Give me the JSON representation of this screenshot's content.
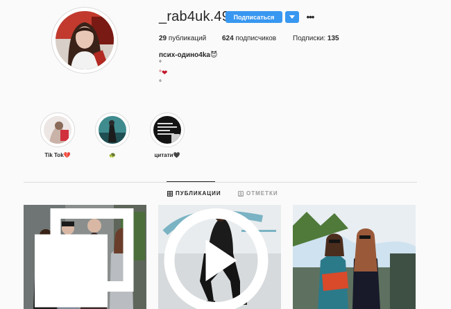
{
  "profile": {
    "username": "_rab4uk.491",
    "follow_label": "Подписаться",
    "more_label": "•••",
    "stats": {
      "posts": "29",
      "posts_label": " публикаций",
      "followers": "624",
      "followers_label": " подписчиков",
      "following_label": "Подписки: ",
      "following": "135"
    },
    "bio": {
      "name": "псих-одино4ka😈",
      "line1": "°",
      "line2": "°❤",
      "line3": "°"
    }
  },
  "highlights": [
    {
      "label": "Tik Tok💔"
    },
    {
      "label": "🐢"
    },
    {
      "label": "цитати🖤"
    }
  ],
  "tabs": [
    {
      "label": "ПУБЛИКАЦИИ",
      "active": true
    },
    {
      "label": "ОТМЕТКИ",
      "active": false
    }
  ],
  "posts": [
    {
      "type": "photo"
    },
    {
      "type": "video"
    },
    {
      "type": "photo"
    }
  ],
  "colors": {
    "accent": "#3897f0",
    "background": "#fafafa",
    "border": "#dbdbdb",
    "text": "#262626",
    "muted": "#999999"
  }
}
